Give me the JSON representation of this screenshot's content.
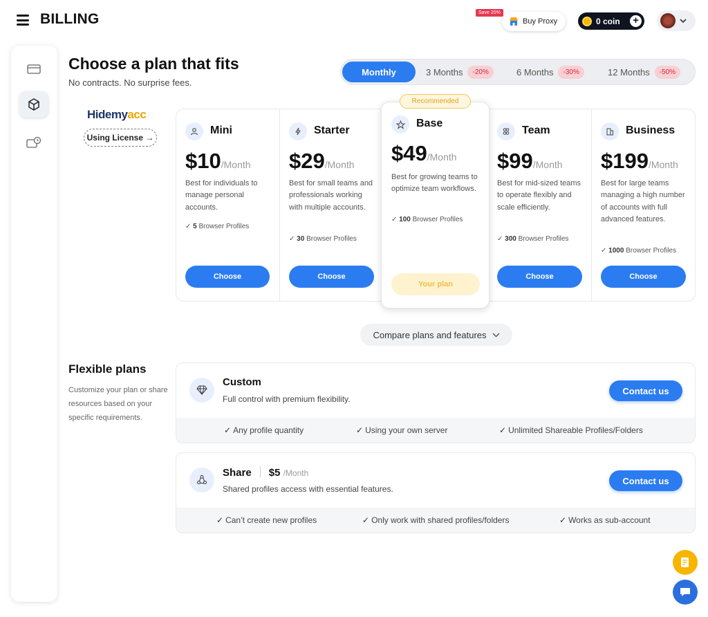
{
  "header": {
    "title": "BILLING",
    "save_badge": "Save 20%",
    "buy_proxy": "Buy Proxy",
    "coin": "0 coin"
  },
  "page": {
    "title": "Choose a plan that fits",
    "subtitle": "No contracts. No surprise fees."
  },
  "periods": [
    {
      "label": "Monthly",
      "discount": ""
    },
    {
      "label": "3 Months",
      "discount": "-20%"
    },
    {
      "label": "6 Months",
      "discount": "-30%"
    },
    {
      "label": "12 Months",
      "discount": "-50%"
    }
  ],
  "brand": {
    "name_a": "Hidemy",
    "name_b": "acc",
    "license": "Using License →"
  },
  "plans": [
    {
      "name": "Mini",
      "price": "$10",
      "per": "/Month",
      "desc": "Best for individuals to manage personal accounts.",
      "profiles": "5",
      "profiles_label": " Browser Profiles",
      "button": "Choose"
    },
    {
      "name": "Starter",
      "price": "$29",
      "per": "/Month",
      "desc": "Best for small teams and professionals working with multiple accounts.",
      "profiles": "30",
      "profiles_label": " Browser Profiles",
      "button": "Choose"
    },
    {
      "name": "Base",
      "price": "$49",
      "per": "/Month",
      "desc": "Best for growing teams to optimize team workflows.",
      "profiles": "100",
      "profiles_label": " Browser Profiles",
      "button": "Your plan",
      "badge": "Recommended"
    },
    {
      "name": "Team",
      "price": "$99",
      "per": "/Month",
      "desc": "Best for mid-sized teams to operate flexibly and scale efficiently.",
      "profiles": "300",
      "profiles_label": " Browser Profiles",
      "button": "Choose"
    },
    {
      "name": "Business",
      "price": "$199",
      "per": "/Month",
      "desc": "Best for large teams managing a high number of accounts with full advanced features.",
      "profiles": "1000",
      "profiles_label": " Browser Profiles",
      "button": "Choose"
    }
  ],
  "compare": "Compare plans and features",
  "flexible": {
    "title": "Flexible plans",
    "subtitle": "Customize your plan or share resources based on your specific requirements."
  },
  "custom": {
    "title": "Custom",
    "desc": "Full control with premium flexibility.",
    "button": "Contact us",
    "features": [
      "Any profile quantity",
      "Using your own server",
      "Unlimited Shareable Profiles/Folders"
    ]
  },
  "share": {
    "title": "Share",
    "price": "$5",
    "per": "/Month",
    "desc": "Shared profiles access with essential features.",
    "button": "Contact us",
    "features": [
      "Can’t create new profiles",
      "Only work with shared profiles/folders",
      "Works as sub-account"
    ]
  },
  "colors": {
    "accent": "#2b7cf0",
    "badge_red": "#e53950",
    "recommended": "#f1c85a"
  }
}
